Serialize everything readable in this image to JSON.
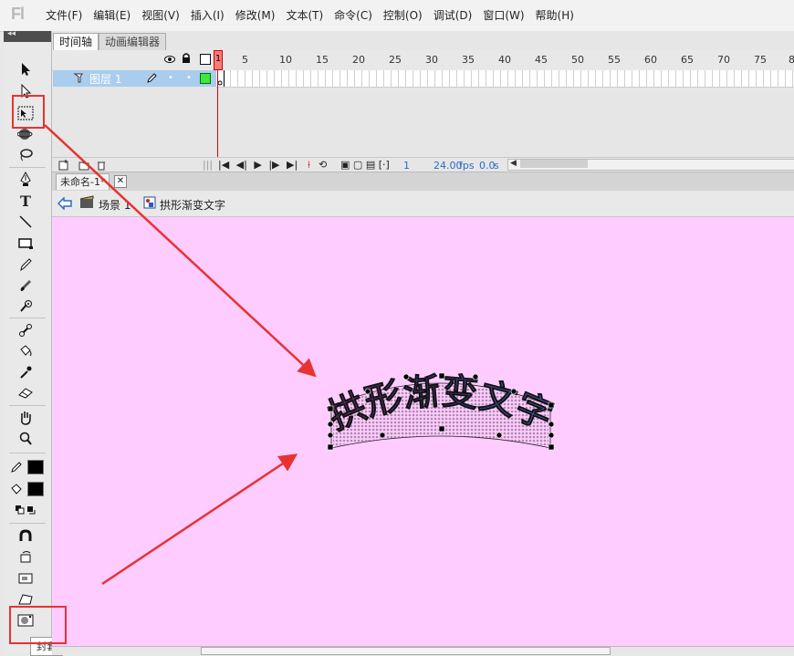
{
  "app": {
    "logo": "Fl"
  },
  "menu": [
    "文件(F)",
    "编辑(E)",
    "视图(V)",
    "插入(I)",
    "修改(M)",
    "文本(T)",
    "命令(C)",
    "控制(O)",
    "调试(D)",
    "窗口(W)",
    "帮助(H)"
  ],
  "panel_tabs": {
    "timeline": "时间轴",
    "motion_editor": "动画编辑器"
  },
  "toolbar_collapse": "◂◂",
  "timeline": {
    "ruler_numbers": [
      "1",
      "5",
      "10",
      "15",
      "20",
      "25",
      "30",
      "35",
      "40",
      "45",
      "50",
      "55",
      "60",
      "65",
      "70",
      "75",
      "8"
    ],
    "layer_name": "图层 1",
    "playhead_frame": "1",
    "current_frame": "1",
    "fps": "24.00",
    "fps_unit": "fps",
    "time": "0.0",
    "time_unit": "s"
  },
  "document": {
    "tab_title": "未命名-1*",
    "close": "✕"
  },
  "editbar": {
    "scene_label": "场景 1",
    "symbol_label": "拱形渐变文字"
  },
  "stage": {
    "text": "拱形渐变文字",
    "background": "#ffccff"
  },
  "tooltip": "封套",
  "colors": {
    "annotation_red": "#e83232",
    "layer_selected": "#a8cdee",
    "playhead": "#ff7b7b"
  }
}
